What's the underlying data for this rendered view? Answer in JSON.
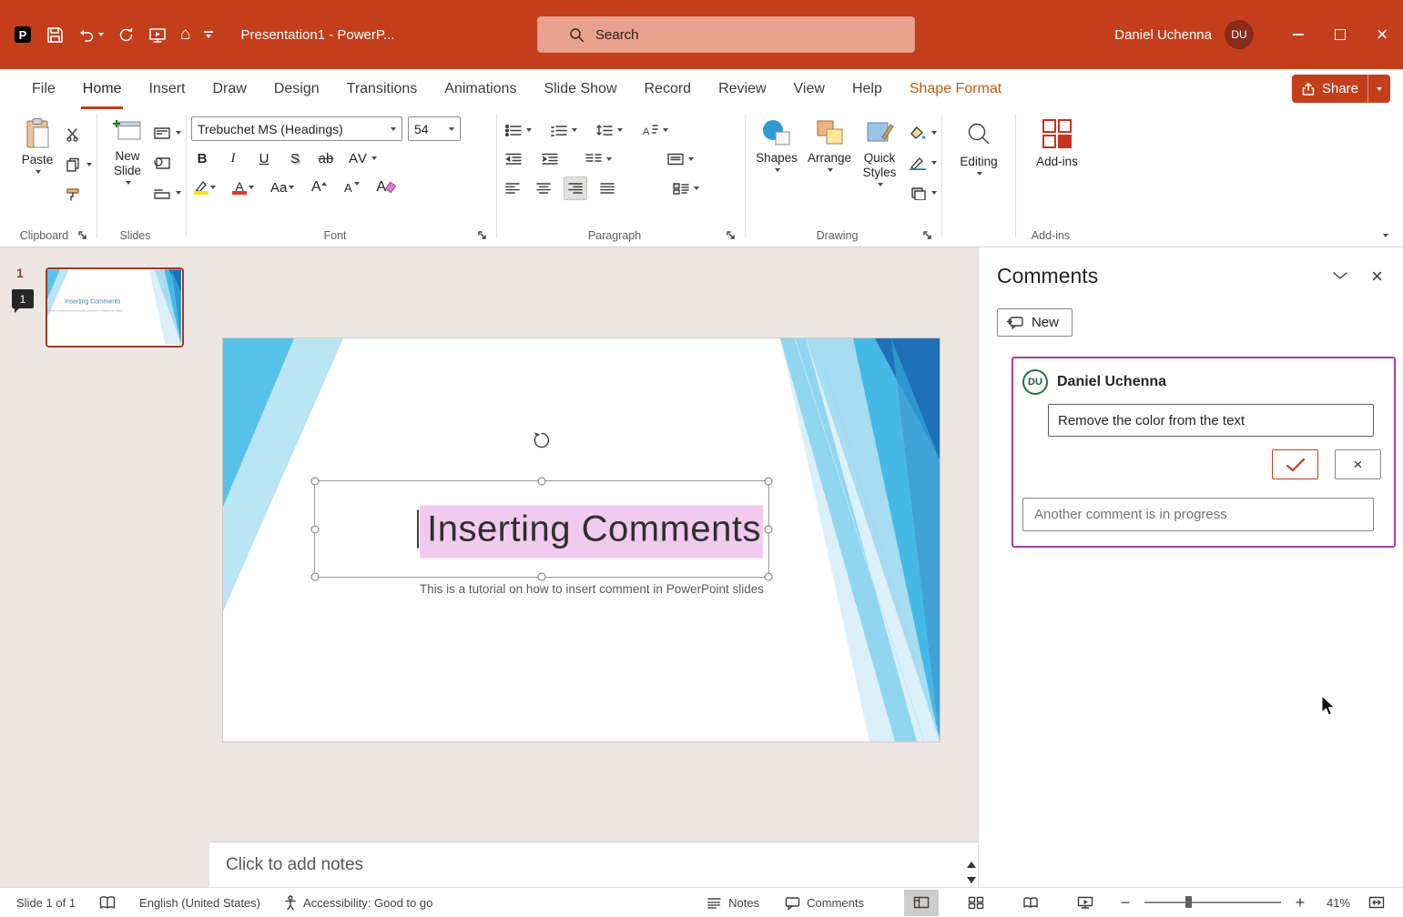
{
  "titlebar": {
    "app_title": "Presentation1  -  PowerP...",
    "search": "Search",
    "user_name": "Daniel Uchenna",
    "user_initials": "DU"
  },
  "tabs": {
    "file": "File",
    "home": "Home",
    "insert": "Insert",
    "draw": "Draw",
    "design": "Design",
    "transitions": "Transitions",
    "animations": "Animations",
    "slide_show": "Slide Show",
    "record": "Record",
    "review": "Review",
    "view": "View",
    "help": "Help",
    "shape_format": "Shape Format"
  },
  "share": "Share",
  "ribbon": {
    "paste": "Paste",
    "group_clipboard": "Clipboard",
    "new_slide": "New Slide",
    "group_slides": "Slides",
    "font_name": "Trebuchet MS (Headings)",
    "font_size": "54",
    "group_font": "Font",
    "glyph_bold": "B",
    "glyph_italic": "I",
    "glyph_underline": "U",
    "glyph_shadow": "S",
    "glyph_strike": "ab",
    "glyph_spacing": "AV",
    "glyph_case": "Aa",
    "glyph_grow": "A",
    "glyph_shrink": "A",
    "glyph_clear": "A",
    "glyph_fontcolor": "A",
    "group_paragraph": "Paragraph",
    "shapes": "Shapes",
    "arrange": "Arrange",
    "quick_styles": "Quick Styles",
    "group_drawing": "Drawing",
    "editing": "Editing",
    "add_ins": "Add-ins",
    "group_add_ins": "Add-ins"
  },
  "thumbnails": {
    "slide_number": "1",
    "comment_badge": "1"
  },
  "slide": {
    "title": "Inserting Comments",
    "subtitle": "This is a tutorial on how to insert comment in PowerPoint slides"
  },
  "comments": {
    "header": "Comments",
    "new_button": "New",
    "author": "Daniel Uchenna",
    "author_initials": "DU",
    "comment_text": "Remove the color from the text",
    "reply_placeholder": "Another comment is in progress"
  },
  "notes": {
    "placeholder": "Click to add notes"
  },
  "statusbar": {
    "slide_indicator": "Slide 1 of 1",
    "language": "English (United States)",
    "accessibility": "Accessibility: Good to go",
    "notes": "Notes",
    "comments": "Comments",
    "zoom": "41%"
  },
  "colors": {
    "brand": "#C43E1C",
    "contextual_tab": "#C55A11",
    "comment_card_border": "#A43FA4",
    "selection_highlight": "#F0CBEE",
    "slide_accent_blue": "#29A8DC"
  }
}
